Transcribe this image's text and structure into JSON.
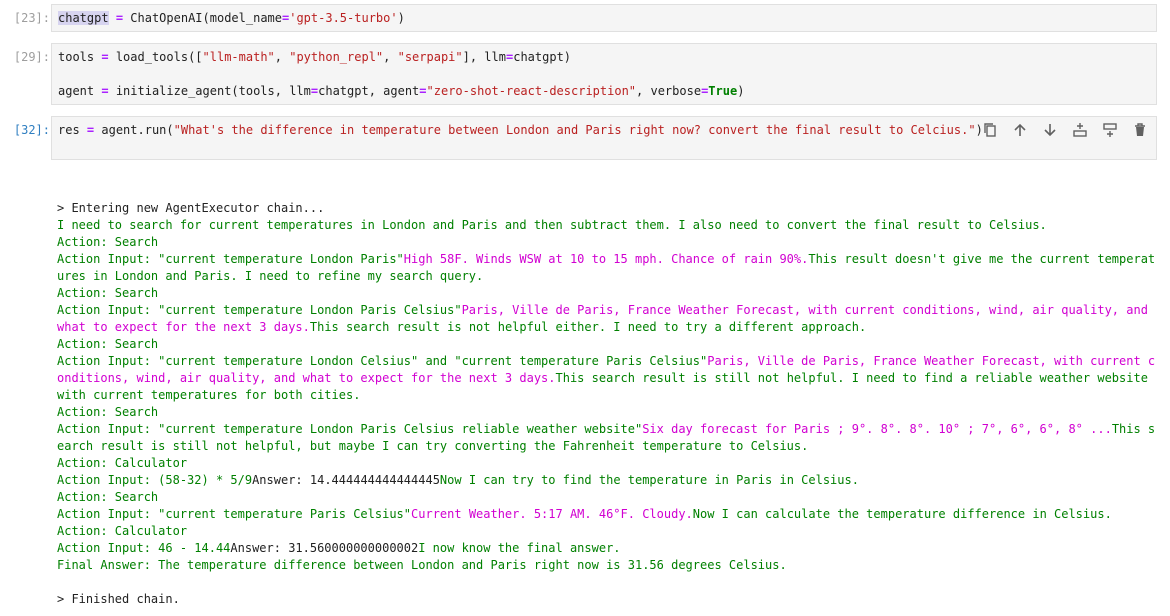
{
  "cells": [
    {
      "prompt": "[23]:",
      "lines": [
        [
          [
            "sel",
            "chatgpt"
          ],
          [
            "t",
            " "
          ],
          [
            "op",
            "="
          ],
          [
            "t",
            " ChatOpenAI(model_name"
          ],
          [
            "op",
            "="
          ],
          [
            "str",
            "'gpt-3.5-turbo'"
          ],
          [
            "t",
            ")"
          ]
        ]
      ]
    },
    {
      "prompt": "[29]:",
      "lines": [
        [
          [
            "t",
            "tools "
          ],
          [
            "op",
            "="
          ],
          [
            "t",
            " load_tools(["
          ],
          [
            "str",
            "\"llm-math\""
          ],
          [
            "t",
            ", "
          ],
          [
            "str",
            "\"python_repl\""
          ],
          [
            "t",
            ", "
          ],
          [
            "str",
            "\"serpapi\""
          ],
          [
            "t",
            "], llm"
          ],
          [
            "op",
            "="
          ],
          [
            "t",
            "chatgpt)"
          ]
        ],
        [],
        [
          [
            "t",
            "agent "
          ],
          [
            "op",
            "="
          ],
          [
            "t",
            " initialize_agent(tools, llm"
          ],
          [
            "op",
            "="
          ],
          [
            "t",
            "chatgpt, agent"
          ],
          [
            "op",
            "="
          ],
          [
            "str",
            "\"zero-shot-react-description\""
          ],
          [
            "t",
            ", verbose"
          ],
          [
            "op",
            "="
          ],
          [
            "kw",
            "True"
          ],
          [
            "t",
            ")"
          ]
        ]
      ]
    },
    {
      "prompt": "[32]:",
      "lines": [
        [
          [
            "t",
            "res "
          ],
          [
            "op",
            "="
          ],
          [
            "t",
            " agent.run("
          ],
          [
            "str",
            "\"What's the difference in temperature between London and Paris right now? convert the final result to Celcius.\""
          ],
          [
            "t",
            ")"
          ]
        ]
      ]
    }
  ],
  "toolbar": [
    "copy-icon",
    "arrow-up-icon",
    "arrow-down-icon",
    "insert-above-icon",
    "insert-below-icon",
    "trash-icon"
  ],
  "output": [
    [
      [
        "b",
        "> Entering new AgentExecutor chain..."
      ]
    ],
    [
      [
        "g",
        "I need to search for current temperatures in London and Paris and then subtract them. I also need to convert the final result to Celsius."
      ]
    ],
    [
      [
        "g",
        "Action: Search"
      ]
    ],
    [
      [
        "g",
        "Action Input: \"current temperature London Paris\""
      ],
      [
        "m",
        "High 58F. Winds WSW at 10 to 15 mph. Chance of rain 90%."
      ],
      [
        "g",
        "This result doesn't give me the current temperatures in London and Paris. I need to refine my search query."
      ]
    ],
    [
      [
        "g",
        "Action: Search"
      ]
    ],
    [
      [
        "g",
        "Action Input: \"current temperature London Paris Celsius\""
      ],
      [
        "m",
        "Paris, Ville de Paris, France Weather Forecast, with current conditions, wind, air quality, and what to expect for the next 3 days."
      ],
      [
        "g",
        "This search result is not helpful either. I need to try a different approach."
      ]
    ],
    [
      [
        "g",
        "Action: Search"
      ]
    ],
    [
      [
        "g",
        "Action Input: \"current temperature London Celsius\" and \"current temperature Paris Celsius\""
      ],
      [
        "m",
        "Paris, Ville de Paris, France Weather Forecast, with current conditions, wind, air quality, and what to expect for the next 3 days."
      ],
      [
        "g",
        "This search result is still not helpful. I need to find a reliable weather website with current temperatures for both cities."
      ]
    ],
    [
      [
        "g",
        "Action: Search"
      ]
    ],
    [
      [
        "g",
        "Action Input: \"current temperature London Paris Celsius reliable weather website\""
      ],
      [
        "m",
        "Six day forecast for Paris ; 9°. 8°. 8°. 10° ; 7°, 6°, 6°, 8° ..."
      ],
      [
        "g",
        "This search result is still not helpful, but maybe I can try converting the Fahrenheit temperature to Celsius."
      ]
    ],
    [
      [
        "g",
        "Action: Calculator"
      ]
    ],
    [
      [
        "g",
        "Action Input: (58-32) * 5/9"
      ],
      [
        "t",
        "Answer: 14.444444444444445"
      ],
      [
        "g",
        "Now I can try to find the temperature in Paris in Celsius."
      ]
    ],
    [
      [
        "g",
        "Action: Search"
      ]
    ],
    [
      [
        "g",
        "Action Input: \"current temperature Paris Celsius\""
      ],
      [
        "m",
        "Current Weather. 5:17 AM. 46°F. Cloudy."
      ],
      [
        "g",
        "Now I can calculate the temperature difference in Celsius."
      ]
    ],
    [
      [
        "g",
        "Action: Calculator"
      ]
    ],
    [
      [
        "g",
        "Action Input: 46 - 14.44"
      ],
      [
        "t",
        "Answer: 31.560000000000002"
      ],
      [
        "g",
        "I now know the final answer."
      ]
    ],
    [
      [
        "g",
        "Final Answer: The temperature difference between London and Paris right now is 31.56 degrees Celsius."
      ]
    ],
    [],
    [
      [
        "b",
        "> Finished chain."
      ]
    ]
  ]
}
